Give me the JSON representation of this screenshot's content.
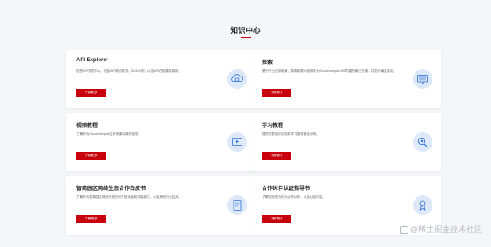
{
  "page": {
    "title": "知识中心"
  },
  "cards": [
    {
      "title": "API Explorer",
      "desc": "您的API开发中心，包括API调试概况、SDK示例，以及API在线模拟调用。",
      "button": "了解更多",
      "icon": "api-cloud-icon"
    },
    {
      "title": "探索",
      "desc": "基于行业应用场景，探索和展示使用华为CloudCampus API构建的解决方案，并提示最佳实践。",
      "button": "了解更多",
      "icon": "monitor-explore-icon"
    },
    {
      "title": "视频教程",
      "desc": "了解华为CloudCampus应用场景和操作指导。",
      "button": "了解更多",
      "icon": "video-play-icon"
    },
    {
      "title": "学习教程",
      "desc": "提供完整培训文档和学习指导路径示例。",
      "button": "了解更多",
      "icon": "learning-search-icon"
    },
    {
      "title": "智简园区网络生态合作白皮书",
      "desc": "了解华为智简园区网络开放的可开放功能和对接能力，以及其他行业应用。",
      "button": "了解更多",
      "icon": "whitepaper-document-icon"
    },
    {
      "title": "合作伙伴认证指导书",
      "desc": "了解如何成为华为合作伙伴，以及认证内容。",
      "button": "了解更多",
      "icon": "partner-certificate-icon"
    }
  ],
  "watermark": {
    "text": "@稀土掘金技术社区"
  },
  "colors": {
    "accent": "#c7000b",
    "icon_blue": "#2a6fd6",
    "icon_bg": "#dde8f8"
  }
}
